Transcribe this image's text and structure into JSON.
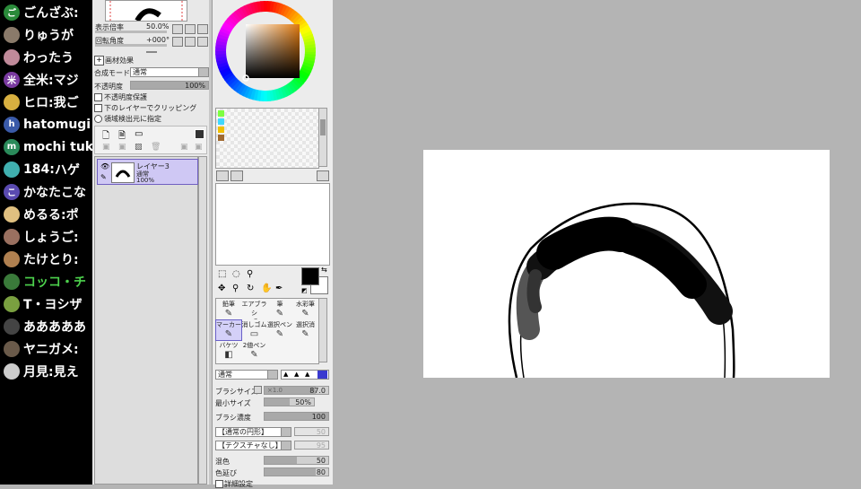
{
  "chat": [
    {
      "name": "ごんざぶ:",
      "msg": "",
      "avatar": "ご",
      "color": "#2a8a3a"
    },
    {
      "name": "りゅうが",
      "msg": "",
      "avatar": "",
      "color": "#8a7a6a"
    },
    {
      "name": "わったう",
      "msg": "",
      "avatar": "",
      "color": "#c08a9a"
    },
    {
      "name": "全米:",
      "msg": "マジ",
      "avatar": "米",
      "color": "#7a3aa0"
    },
    {
      "name": "ヒロ:",
      "msg": "我ご",
      "avatar": "",
      "color": "#d8b040"
    },
    {
      "name": "hatomugi",
      "msg": "",
      "avatar": "h",
      "color": "#3a5aa8"
    },
    {
      "name": "mochi tuk",
      "msg": "",
      "avatar": "m",
      "color": "#2a8a5a"
    },
    {
      "name": "184:",
      "msg": "ハゲ",
      "avatar": "",
      "color": "#40b0b0"
    },
    {
      "name": "かなたこな",
      "msg": "",
      "avatar": "こ",
      "color": "#5a4ab0"
    },
    {
      "name": "めるる:",
      "msg": "ポ",
      "avatar": "",
      "color": "#e0c080"
    },
    {
      "name": "しょうご:",
      "msg": "",
      "avatar": "",
      "color": "#9a7060"
    },
    {
      "name": "たけとり:",
      "msg": "",
      "avatar": "",
      "color": "#b08050"
    },
    {
      "name": "コッコ・チ",
      "msg": "",
      "avatar": "",
      "color": "#3a7a3a",
      "nameColor": "#4cd04c"
    },
    {
      "name": "T・ヨシザ",
      "msg": "",
      "avatar": "",
      "color": "#7aa040"
    },
    {
      "name": "あああああ",
      "msg": "",
      "avatar": "",
      "color": "#444444"
    },
    {
      "name": "ヤニガメ:",
      "msg": "",
      "avatar": "",
      "color": "#6a5a4a"
    },
    {
      "name": "月見:",
      "msg": "見え",
      "avatar": "",
      "color": "#cccccc"
    }
  ],
  "layer_panel": {
    "display_scale_label": "表示倍率",
    "display_scale_value": "50.0%",
    "rotation_label": "回転角度",
    "rotation_value": "+000°",
    "material_effect": "画材効果",
    "blend_mode_label": "合成モード",
    "blend_mode_value": "通常",
    "opacity_label": "不透明度",
    "opacity_value": "100%",
    "opacity_fraction": 1.0,
    "protect_opacity": "不透明度保護",
    "clip_below": "下のレイヤーでクリッピング",
    "selection_source": "領域検出元に指定",
    "layer_name": "レイヤー3",
    "layer_mode": "通常",
    "layer_opacity": "100%"
  },
  "tool_panel": {
    "tools": [
      {
        "label": "鉛筆",
        "icon": "✎"
      },
      {
        "label": "エアブラシ",
        "icon": "✐"
      },
      {
        "label": "筆",
        "icon": "✎"
      },
      {
        "label": "水彩筆",
        "icon": "✎"
      },
      {
        "label": "マーカー",
        "icon": "✎"
      },
      {
        "label": "消しゴム",
        "icon": "▭"
      },
      {
        "label": "選択ペン",
        "icon": "✎"
      },
      {
        "label": "選択消",
        "icon": "✎"
      },
      {
        "label": "バケツ",
        "icon": "◧"
      },
      {
        "label": "2値ペン",
        "icon": "✎"
      }
    ],
    "brush_mode": "通常",
    "brush_size_label": "ブラシサイズ",
    "brush_size_mult": "×1.0",
    "brush_size_value": "87.0",
    "min_size_label": "最小サイズ",
    "min_size_value": "50%",
    "min_size_fraction": 0.5,
    "density_label": "ブラシ濃度",
    "density_value": "100",
    "density_fraction": 1.0,
    "shape_select": "【通常の円形】",
    "texture_select": "【テクスチャなし】",
    "shape_strength": "50",
    "texture_strength": "95",
    "blend_label": "混色",
    "blend_value": "50",
    "blend_fraction": 0.5,
    "stretch_label": "色延び",
    "stretch_value": "80",
    "stretch_fraction": 0.8,
    "detail_label": "詳細設定"
  },
  "colors": {
    "chat_bg": "#000000",
    "panel_bg": "#e8e8e8",
    "canvas_bg": "#ffffff",
    "area_bg": "#b4b4b4",
    "selected_layer": "#cfc8f4",
    "selected_tool": "#d4d0f8",
    "swatches": [
      "#7dff40",
      "#40d8ff",
      "#f0c000",
      "#a06a30"
    ]
  }
}
